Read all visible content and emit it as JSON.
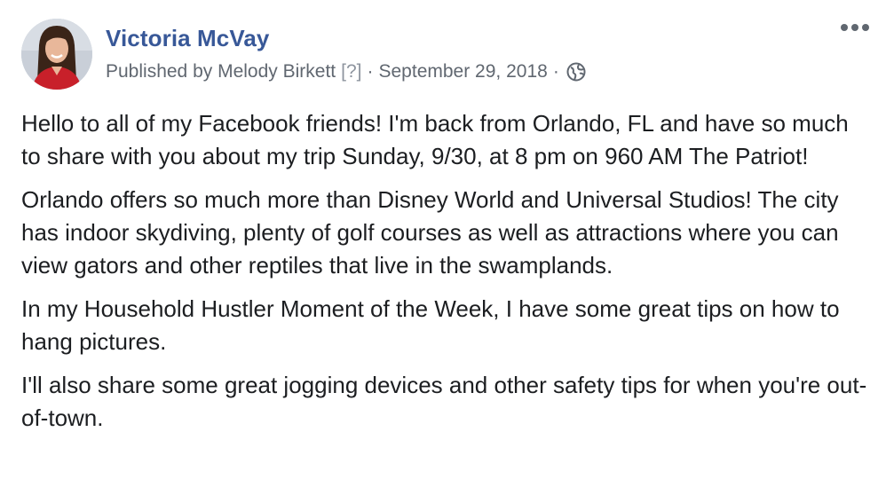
{
  "post": {
    "author_name": "Victoria McVay",
    "published_by_label": "Published by Melody Birkett",
    "help_marker": "[?]",
    "separator": "·",
    "date": "September 29, 2018",
    "privacy_icon": "globe-icon",
    "more_icon": "more-options-icon",
    "paragraphs": [
      "Hello to all of my Facebook friends! I'm back from Orlando, FL and have so much to share with you about my trip Sunday, 9/30, at 8 pm on 960 AM The Patriot!",
      "Orlando offers so much more than Disney World and Universal Studios! The city has indoor skydiving, plenty of golf courses as well as attractions where you can view gators and other reptiles that live in the swamplands.",
      "In my Household Hustler Moment of the Week, I have some great tips on how to hang pictures.",
      "I'll also share some great jogging devices and other safety tips for when you're out-of-town."
    ]
  },
  "colors": {
    "author": "#385898",
    "meta": "#606770",
    "body_text": "#1c1e21"
  }
}
